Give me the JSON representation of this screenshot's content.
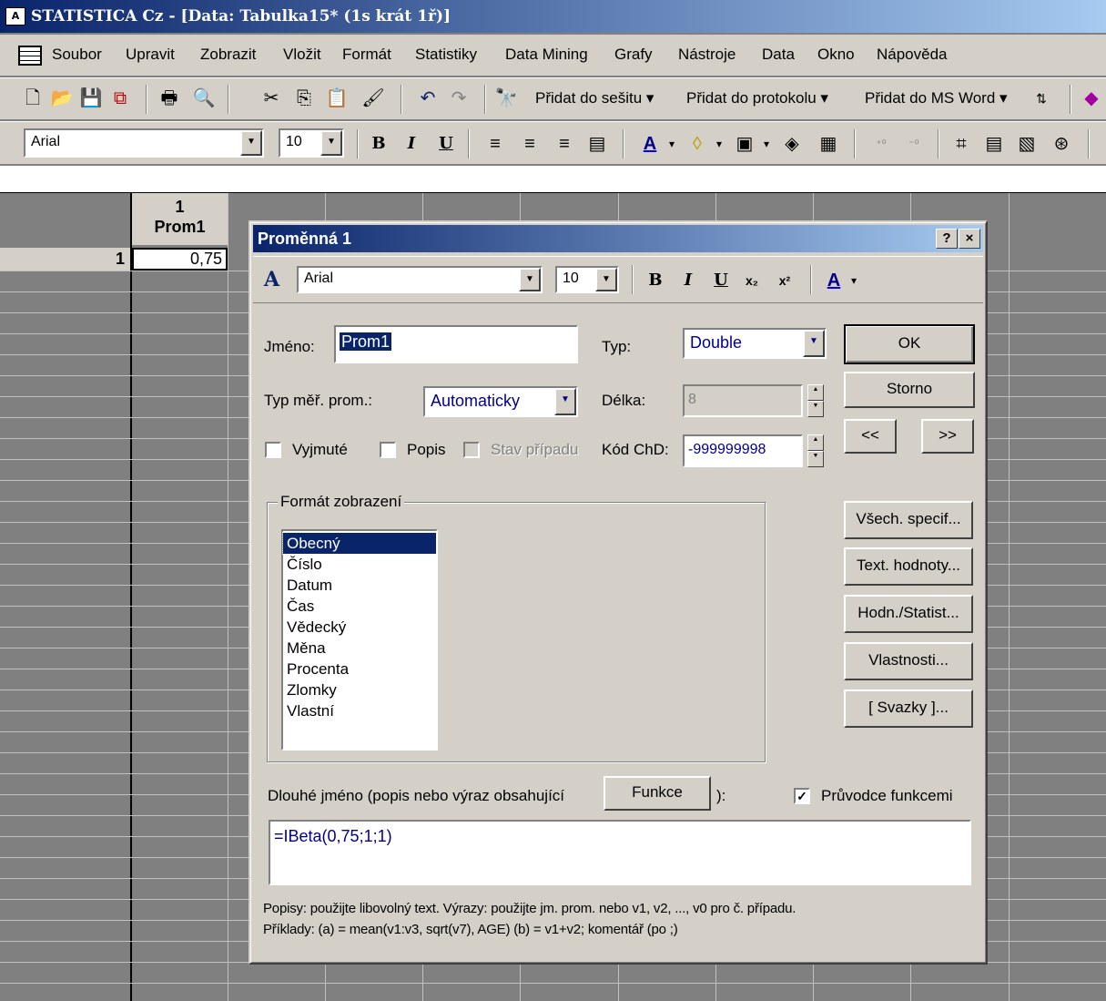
{
  "app": {
    "title": "STATISTICA Cz - [Data: Tabulka15* (1s krát 1ř)]"
  },
  "menu": [
    "Soubor",
    "Upravit",
    "Zobrazit",
    "Vložit",
    "Formát",
    "Statistiky",
    "Data Mining",
    "Grafy",
    "Nástroje",
    "Data",
    "Okno",
    "Nápověda"
  ],
  "toolbar": {
    "add_workbook": "Přidat do sešitu",
    "add_report": "Přidat do protokolu",
    "add_msword": "Přidat do MS Word",
    "font": "Arial",
    "font_size": "10"
  },
  "sheet": {
    "col_number": "1",
    "col_name": "Prom1",
    "row_number": "1",
    "cell_value": "0,75"
  },
  "dialog": {
    "title": "Proměnná 1",
    "help": "?",
    "close": "×",
    "font": "Arial",
    "font_size": "10",
    "name_label": "Jméno:",
    "name_value": "Prom1",
    "type_label": "Typ:",
    "type_value": "Double",
    "meas_label": "Typ měř. prom.:",
    "meas_value": "Automaticky",
    "length_label": "Délka:",
    "length_value": "8",
    "excluded_label": "Vyjmuté",
    "desc_label": "Popis",
    "case_state_label": "Stav případu",
    "md_label": "Kód ChD:",
    "md_value": "-999999998",
    "ok": "OK",
    "cancel": "Storno",
    "prev": "<<",
    "next": ">>",
    "all_specs": "Všech. specif...",
    "text_values": "Text. hodnoty...",
    "values_stats": "Hodn./Statist...",
    "properties": "Vlastnosti...",
    "links": "[ Svazky ]...",
    "format_group": "Formát zobrazení",
    "formats": [
      "Obecný",
      "Číslo",
      "Datum",
      "Čas",
      "Vědecký",
      "Měna",
      "Procenta",
      "Zlomky",
      "Vlastní"
    ],
    "selected_format": "Obecný",
    "long_name_label": "Dlouhé jméno (popis nebo výraz obsahující",
    "functions_btn": "Funkce",
    "long_name_close": "):",
    "wizard_label": "Průvodce funkcemi",
    "formula": "=IBeta(0,75;1;1)",
    "hint1": "Popisy: použijte libovolný text.  Výrazy: použijte jm. prom. nebo v1, v2, ..., v0 pro č. případu.",
    "hint2": "Příklady:  (a) = mean(v1:v3, sqrt(v7), AGE)  (b) = v1+v2; komentář (po ;)"
  }
}
